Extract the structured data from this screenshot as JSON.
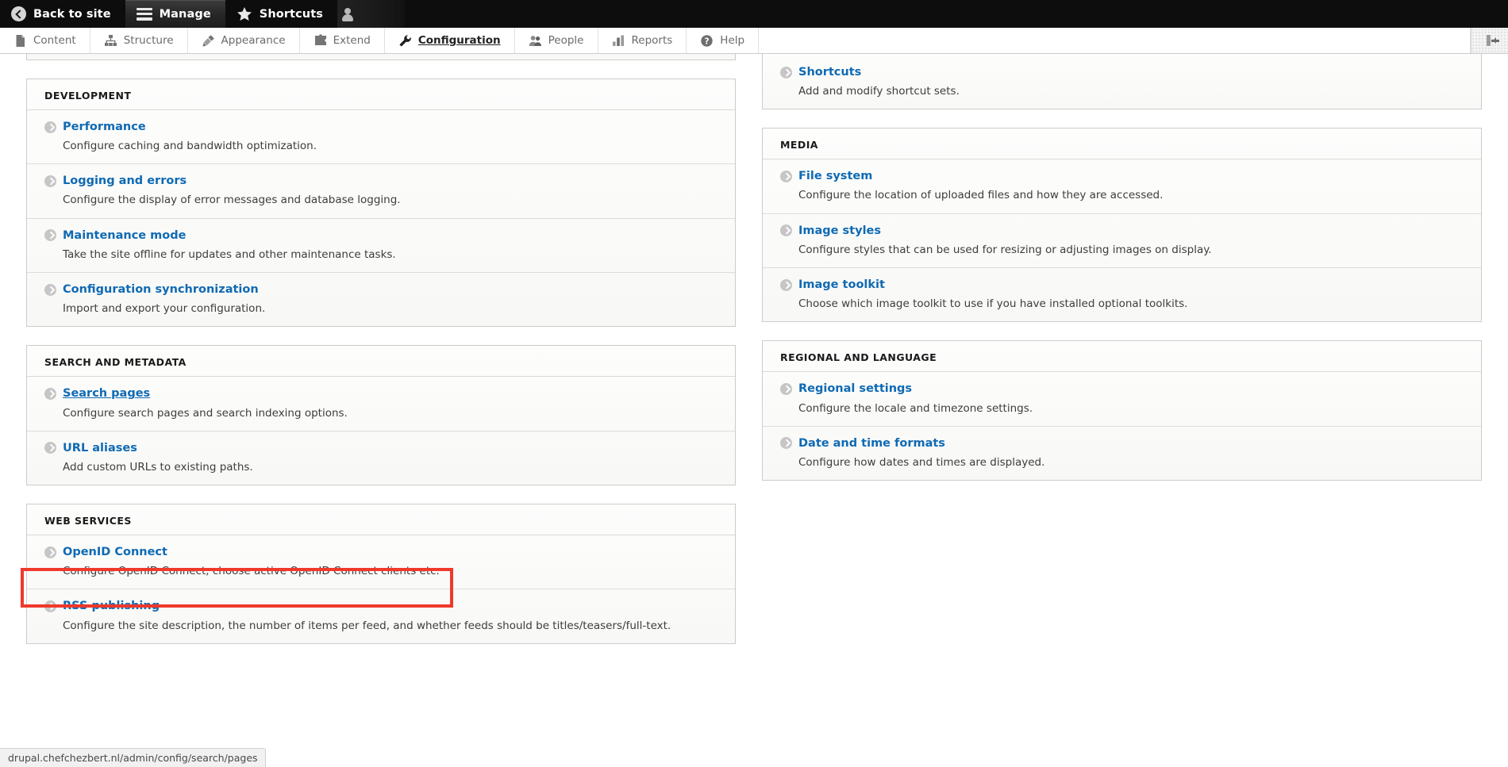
{
  "toolbar": {
    "back_to_site": "Back to site",
    "manage": "Manage",
    "shortcuts": "Shortcuts",
    "tray": [
      {
        "label": "Content",
        "icon": "document-icon",
        "active": false
      },
      {
        "label": "Structure",
        "icon": "sitemap-icon",
        "active": false
      },
      {
        "label": "Appearance",
        "icon": "paintbrush-icon",
        "active": false
      },
      {
        "label": "Extend",
        "icon": "puzzle-icon",
        "active": false
      },
      {
        "label": "Configuration",
        "icon": "wrench-icon",
        "active": true
      },
      {
        "label": "People",
        "icon": "people-icon",
        "active": false
      },
      {
        "label": "Reports",
        "icon": "bar-chart-icon",
        "active": false
      },
      {
        "label": "Help",
        "icon": "question-circle-icon",
        "active": false
      }
    ]
  },
  "left_column": [
    {
      "title": "DEVELOPMENT",
      "items": [
        {
          "label": "Performance",
          "desc": "Configure caching and bandwidth optimization.",
          "hovered": false
        },
        {
          "label": "Logging and errors",
          "desc": "Configure the display of error messages and database logging.",
          "hovered": false
        },
        {
          "label": "Maintenance mode",
          "desc": "Take the site offline for updates and other maintenance tasks.",
          "hovered": false
        },
        {
          "label": "Configuration synchronization",
          "desc": "Import and export your configuration.",
          "hovered": false
        }
      ]
    },
    {
      "title": "SEARCH AND METADATA",
      "items": [
        {
          "label": "Search pages",
          "desc": "Configure search pages and search indexing options.",
          "hovered": true
        },
        {
          "label": "URL aliases",
          "desc": "Add custom URLs to existing paths.",
          "hovered": false
        }
      ]
    },
    {
      "title": "WEB SERVICES",
      "items": [
        {
          "label": "OpenID Connect",
          "desc": "Configure OpenID Connect, choose active OpenID Connect clients etc.",
          "hovered": false,
          "highlighted": true
        },
        {
          "label": "RSS publishing",
          "desc": "Configure the site description, the number of items per feed, and whether feeds should be titles/teasers/full-text.",
          "hovered": false
        }
      ]
    }
  ],
  "right_column": [
    {
      "title": "",
      "partial": true,
      "items": [
        {
          "label": "Shortcuts",
          "desc": "Add and modify shortcut sets.",
          "hovered": false
        }
      ]
    },
    {
      "title": "MEDIA",
      "items": [
        {
          "label": "File system",
          "desc": "Configure the location of uploaded files and how they are accessed.",
          "hovered": false
        },
        {
          "label": "Image styles",
          "desc": "Configure styles that can be used for resizing or adjusting images on display.",
          "hovered": false
        },
        {
          "label": "Image toolkit",
          "desc": "Choose which image toolkit to use if you have installed optional toolkits.",
          "hovered": false
        }
      ]
    },
    {
      "title": "REGIONAL AND LANGUAGE",
      "items": [
        {
          "label": "Regional settings",
          "desc": "Configure the locale and timezone settings.",
          "hovered": false
        },
        {
          "label": "Date and time formats",
          "desc": "Configure how dates and times are displayed.",
          "hovered": false
        }
      ]
    }
  ],
  "statusbar": {
    "url": "drupal.chefchezbert.nl/admin/config/search/pages"
  },
  "colors": {
    "link": "#0f6ab4",
    "toolbar_bg": "#0d0d0d",
    "highlight": "#f0392b",
    "panel_bg": "#fcfcfa"
  }
}
